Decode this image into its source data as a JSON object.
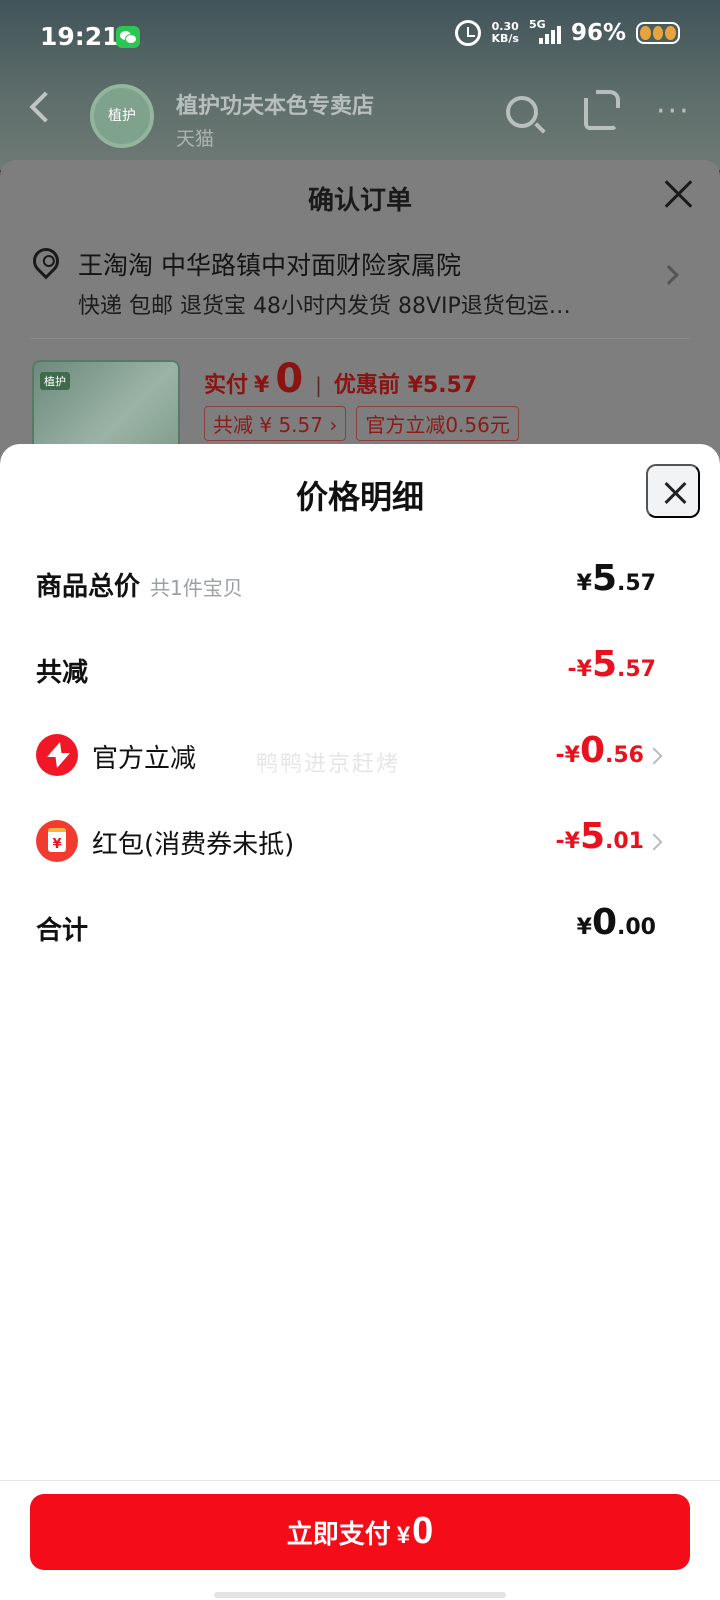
{
  "status_bar": {
    "time": "19:21",
    "net_speed_value": "0.30",
    "net_speed_unit": "KB/s",
    "network": "5G",
    "battery": "96%",
    "wechat_icon": "wechat-icon",
    "alarm_icon": "alarm-icon"
  },
  "store_header": {
    "name": "植护功夫本色专卖店",
    "platform": "天猫",
    "logo_text": "植护"
  },
  "order_sheet": {
    "title": "确认订单",
    "address": "王淘淘 中华路镇中对面财险家属院",
    "services": "快递 包邮 退货宝 48小时内发货 88VIP退货包运…",
    "product_badge": "植护",
    "paid_label": "实付",
    "paid_yen": "¥",
    "paid_amount": "0",
    "before_discount": "优惠前 ¥5.57",
    "tags": [
      "共减 ¥ 5.57 ›",
      "官方立减0.56元"
    ]
  },
  "price_detail": {
    "title": "价格明细",
    "watermark": "鸭鸭进京赶烤",
    "rows": {
      "goods_total": {
        "label": "商品总价",
        "hint": "共1件宝贝",
        "sign": "",
        "yen": "¥",
        "int": "5",
        "dec": ".57"
      },
      "total_discount": {
        "label": "共减",
        "sign": "-",
        "yen": "¥",
        "int": "5",
        "dec": ".57"
      },
      "official_discount": {
        "label": "官方立减",
        "sign": "-",
        "yen": "¥",
        "int": "0",
        "dec": ".56"
      },
      "red_packet": {
        "label": "红包(消费券未抵)",
        "sign": "-",
        "yen": "¥",
        "int": "5",
        "dec": ".01"
      },
      "total": {
        "label": "合计",
        "sign": "",
        "yen": "¥",
        "int": "0",
        "dec": ".00"
      }
    }
  },
  "footer": {
    "pay_label": "立即支付",
    "pay_yen": "¥",
    "pay_amount": "0"
  },
  "colors": {
    "accent_red": "#f40c19",
    "discount_red": "#e8121f"
  }
}
